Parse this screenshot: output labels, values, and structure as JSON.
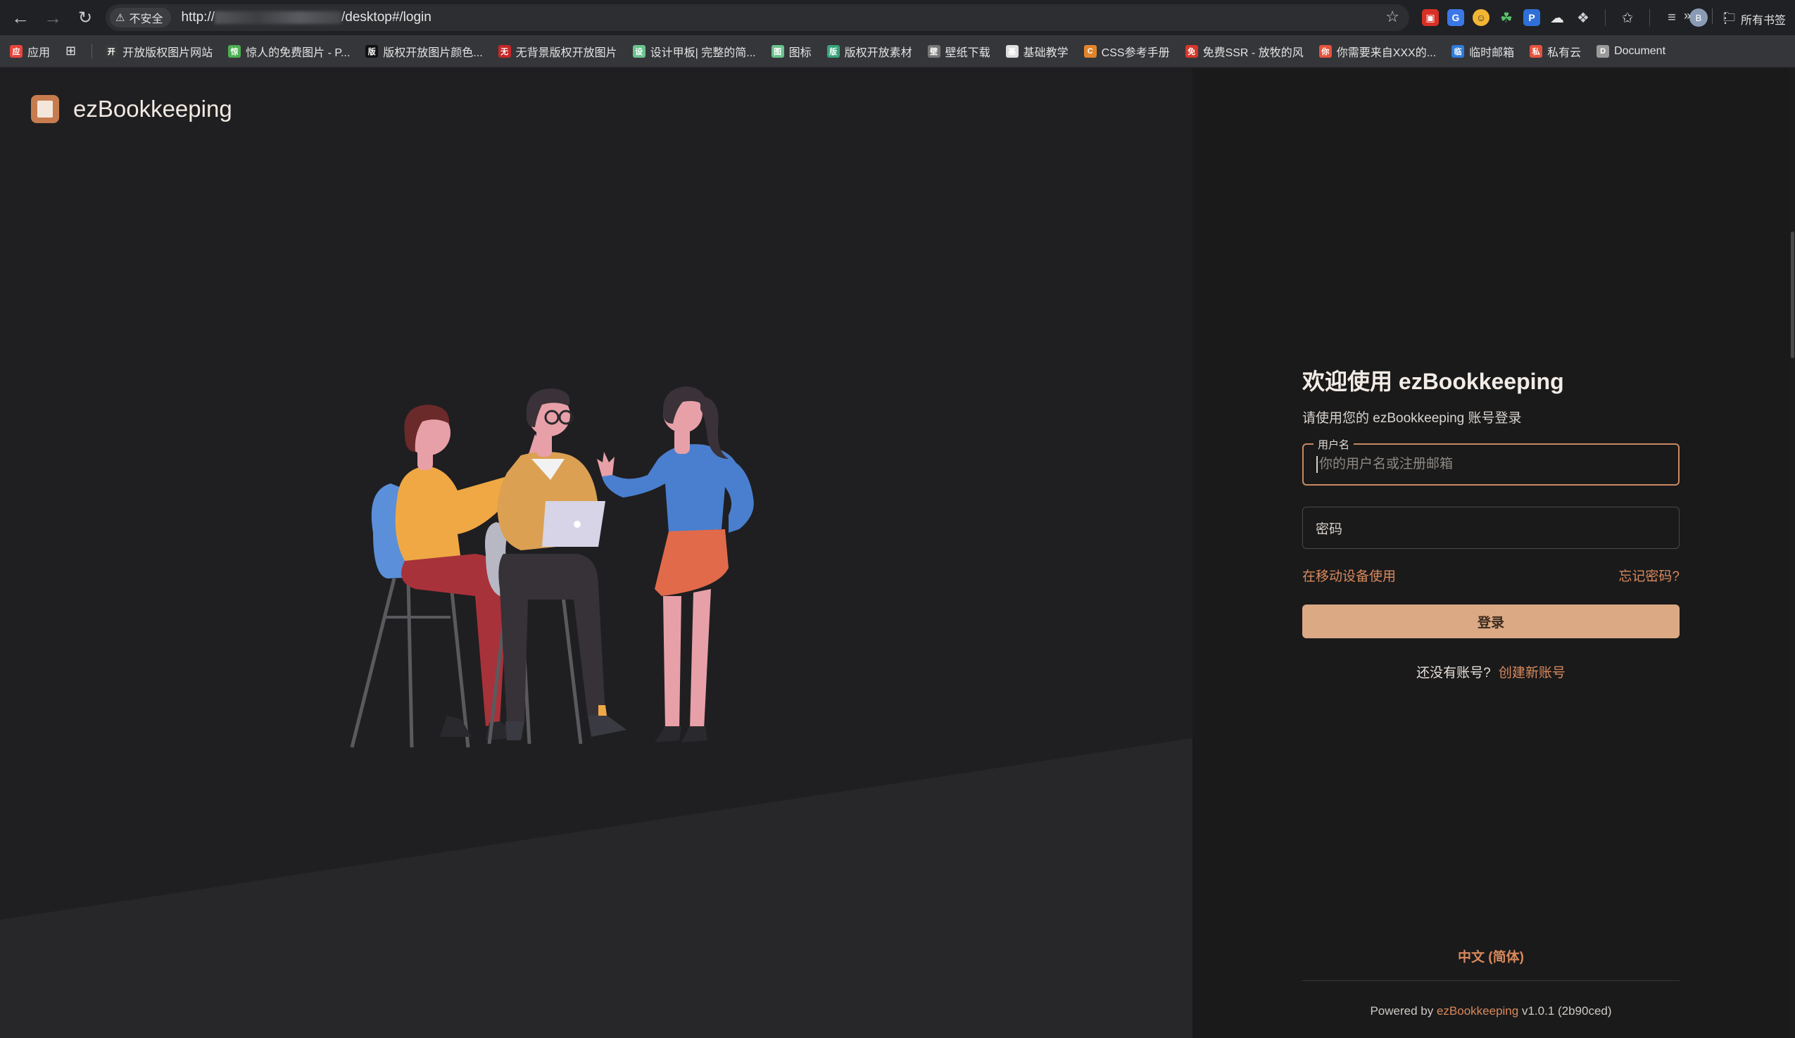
{
  "browser": {
    "security_label": "不安全",
    "url_prefix": "http://",
    "url_suffix": "/desktop#/login",
    "bookmarks": [
      {
        "label": "应用",
        "icon": "apps-grid-icon",
        "color": "#e8453c"
      },
      {
        "label": "开放版权图片网站",
        "icon": "site-favicon",
        "color": "#3a3a3a"
      },
      {
        "label": "惊人的免费图片 - P...",
        "icon": "px-favicon",
        "color": "#4caf50"
      },
      {
        "label": "版权开放图片颜色...",
        "icon": "p-favicon",
        "color": "#111111"
      },
      {
        "label": "无背景版权开放图片",
        "icon": "red-favicon",
        "color": "#c62828"
      },
      {
        "label": "设计甲板| 完整的简...",
        "icon": "d-favicon",
        "color": "#6ac28e"
      },
      {
        "label": "图标",
        "icon": "d-favicon",
        "color": "#6ac28e"
      },
      {
        "label": "版权开放素材",
        "icon": "d-favicon",
        "color": "#37a37a"
      },
      {
        "label": "壁纸下载",
        "icon": "wallpaper-favicon",
        "color": "#777777"
      },
      {
        "label": "基础教学",
        "icon": "x-favicon",
        "color": "#dddddd"
      },
      {
        "label": "CSS参考手册",
        "icon": "css-favicon",
        "color": "#e0852b"
      },
      {
        "label": "免费SSR - 放牧的风",
        "icon": "flag-favicon",
        "color": "#d6372a"
      },
      {
        "label": "你需要来自XXX的...",
        "icon": "c-favicon",
        "color": "#e5533d"
      },
      {
        "label": "临时邮箱",
        "icon": "shield-favicon",
        "color": "#2f7bd8"
      },
      {
        "label": "私有云",
        "icon": "c-favicon",
        "color": "#e5533d"
      },
      {
        "label": "Document",
        "icon": "globe-favicon",
        "color": "#9a9a9a"
      }
    ],
    "all_bookmarks": "所有书签",
    "avatar_letter": "B"
  },
  "brand": {
    "name": "ezBookkeeping"
  },
  "login": {
    "title": "欢迎使用 ezBookkeeping",
    "subtitle": "请使用您的 ezBookkeeping 账号登录",
    "username_label": "用户名",
    "username_placeholder": "你的用户名或注册邮箱",
    "password_label": "密码",
    "mobile_link": "在移动设备使用",
    "forgot_link": "忘记密码?",
    "login_button": "登录",
    "no_account": "还没有账号?",
    "create_account": "创建新账号"
  },
  "footer": {
    "language": "中文 (简体)",
    "powered_by": "Powered by",
    "app_link": "ezBookkeeping",
    "version": "v1.0.1 (2b90ced)"
  },
  "theme": {
    "accent": "#d9895c",
    "button_bg": "#dba983",
    "left_bg": "#1f1f21",
    "right_bg": "#1a1a1b"
  }
}
